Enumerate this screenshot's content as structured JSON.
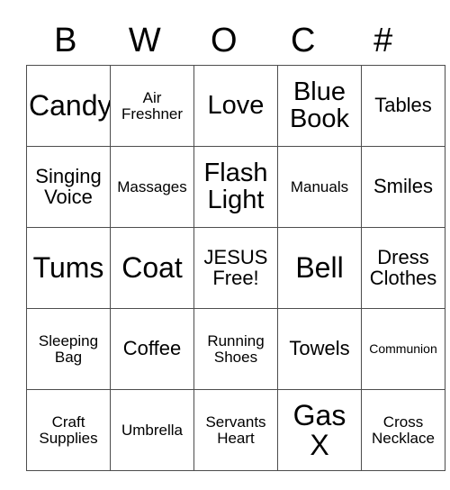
{
  "card": {
    "headers": [
      "B",
      "W",
      "O",
      "C",
      "#"
    ],
    "rows": [
      [
        {
          "text": "Candy",
          "size": "s-xl"
        },
        {
          "text": "Air\nFreshner",
          "size": "s-sm"
        },
        {
          "text": "Love",
          "size": "s-lg"
        },
        {
          "text": "Blue\nBook",
          "size": "s-lg"
        },
        {
          "text": "Tables",
          "size": "s-md"
        }
      ],
      [
        {
          "text": "Singing\nVoice",
          "size": "s-md"
        },
        {
          "text": "Massages",
          "size": "s-sm"
        },
        {
          "text": "Flash\nLight",
          "size": "s-lg"
        },
        {
          "text": "Manuals",
          "size": "s-sm"
        },
        {
          "text": "Smiles",
          "size": "s-md"
        }
      ],
      [
        {
          "text": "Tums",
          "size": "s-xl"
        },
        {
          "text": "Coat",
          "size": "s-xl"
        },
        {
          "text": "JESUS\nFree!",
          "size": "s-md"
        },
        {
          "text": "Bell",
          "size": "s-xl"
        },
        {
          "text": "Dress\nClothes",
          "size": "s-md"
        }
      ],
      [
        {
          "text": "Sleeping\nBag",
          "size": "s-sm"
        },
        {
          "text": "Coffee",
          "size": "s-md"
        },
        {
          "text": "Running\nShoes",
          "size": "s-sm"
        },
        {
          "text": "Towels",
          "size": "s-md"
        },
        {
          "text": "Communion",
          "size": "s-xs"
        }
      ],
      [
        {
          "text": "Craft\nSupplies",
          "size": "s-sm"
        },
        {
          "text": "Umbrella",
          "size": "s-sm"
        },
        {
          "text": "Servants\nHeart",
          "size": "s-sm"
        },
        {
          "text": "Gas\nX",
          "size": "s-xl"
        },
        {
          "text": "Cross\nNecklace",
          "size": "s-sm"
        }
      ]
    ]
  },
  "colors": {
    "border": "#4d4d4d",
    "text": "#000000",
    "background": "#ffffff"
  }
}
